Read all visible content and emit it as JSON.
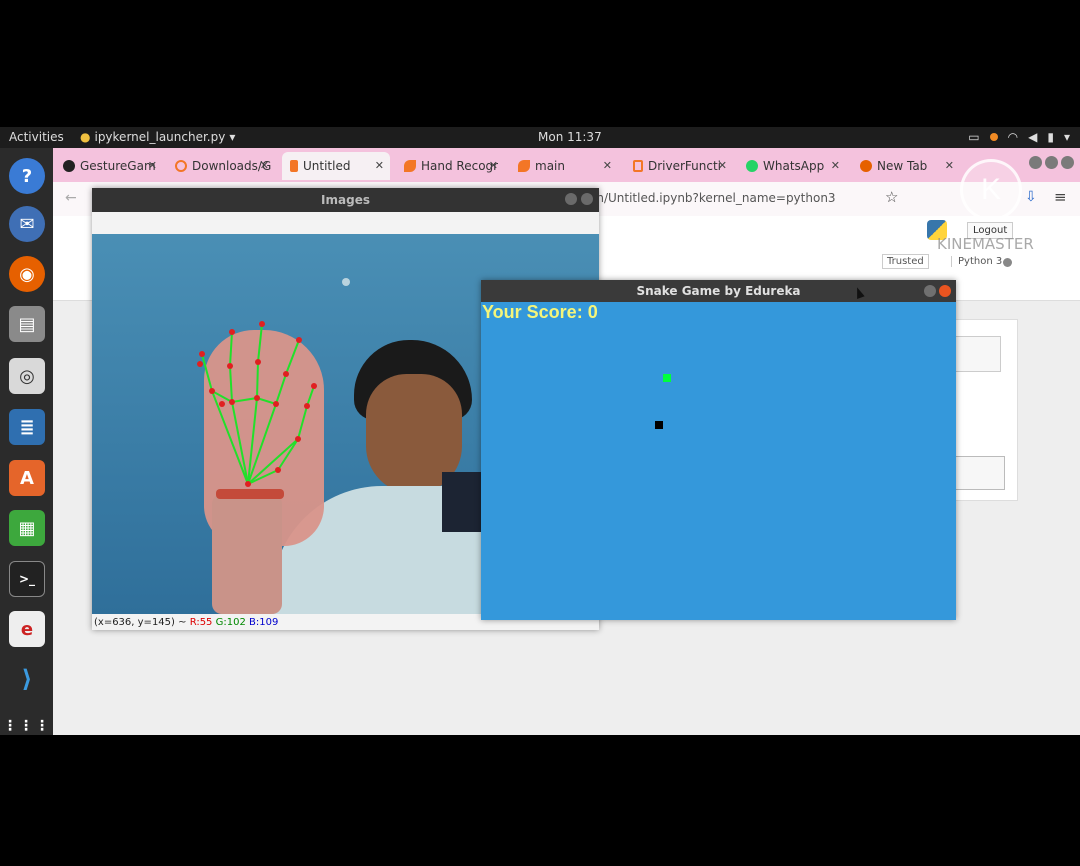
{
  "topbar": {
    "activities": "Activities",
    "app_name": "ipykernel_launcher.py",
    "clock": "Mon 11:37"
  },
  "tabs": [
    {
      "label": "GestureGam",
      "icon": "github-icon",
      "color": "#222222"
    },
    {
      "label": "Downloads/G",
      "icon": "jupyter-icon",
      "color": "#f37626"
    },
    {
      "label": "Untitled",
      "icon": "hourglass-icon",
      "color": "#f37626"
    },
    {
      "label": "Hand Recogr",
      "icon": "jupyter-icon",
      "color": "#f37626"
    },
    {
      "label": "main",
      "icon": "jupyter-icon",
      "color": "#f37626"
    },
    {
      "label": "DriverFuncti",
      "icon": "file-icon",
      "color": "#f37626"
    },
    {
      "label": "WhatsApp",
      "icon": "whatsapp-icon",
      "color": "#25d366"
    },
    {
      "label": "New Tab",
      "icon": "firefox-icon",
      "color": "#e66000"
    }
  ],
  "browser": {
    "url": "in/Untitled.ipynb?kernel_name=python3",
    "logout": "Logout",
    "trusted": "Trusted",
    "kernel": "Python 3",
    "watermark": "KINEMASTER"
  },
  "images_window": {
    "title": "Images",
    "status_coords": "(x=636, y=145) ~",
    "status_r": "R:55",
    "status_g": "G:102",
    "status_b": "B:109"
  },
  "snake_window": {
    "title": "Snake Game by Edureka",
    "score_label": "Your Score: 0"
  }
}
